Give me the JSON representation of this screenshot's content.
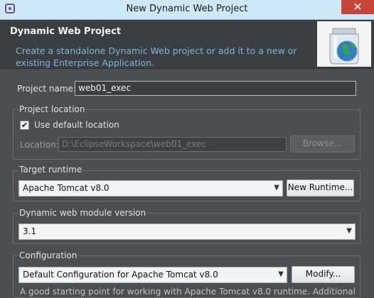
{
  "window": {
    "title": "New Dynamic Web Project",
    "close_glyph": "✕"
  },
  "header": {
    "title": "Dynamic Web Project",
    "description": "Create a standalone Dynamic Web project or add it to a new or existing Enterprise Application.",
    "image_icon": "web-project-jar-globe-icon"
  },
  "project": {
    "name_label": "Project name:",
    "name_value": "web01_exec"
  },
  "location": {
    "legend": "Project location",
    "use_default_label": "Use default location",
    "use_default_checked": true,
    "location_label": "Location:",
    "location_value": "D:\\EclipseWorkspace\\web01_exec",
    "browse_label": "Browse..."
  },
  "target_runtime": {
    "legend": "Target runtime",
    "selected": "Apache Tomcat v8.0",
    "new_runtime_label": "New Runtime..."
  },
  "module_version": {
    "legend": "Dynamic web module version",
    "selected": "3.1"
  },
  "configuration": {
    "legend": "Configuration",
    "selected": "Default Configuration for Apache Tomcat v8.0",
    "modify_label": "Modify...",
    "hint": "A good starting point for working with Apache Tomcat v8.0 runtime. Additional"
  },
  "colors": {
    "background": "#4b4f52",
    "header_background": "#3b3f42",
    "accent_text": "#7bb7d8",
    "title_bar": "#cde8f7",
    "close_button": "#c7463b"
  }
}
